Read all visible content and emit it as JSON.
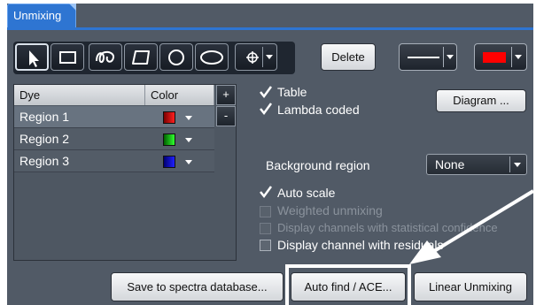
{
  "tab": {
    "title": "Unmixing"
  },
  "toolbar": {
    "tools": [
      {
        "icon": "arrow-pointer-icon",
        "active": true
      },
      {
        "icon": "rectangle-icon"
      },
      {
        "icon": "bezier-icon"
      },
      {
        "icon": "polygon-icon"
      },
      {
        "icon": "circle-icon"
      },
      {
        "icon": "ellipse-icon"
      },
      {
        "icon": "crosshair-icon"
      }
    ],
    "delete_label": "Delete",
    "line_style_icon": "line-style-icon",
    "color_value": "#ff0000"
  },
  "dye_table": {
    "headers": {
      "dye": "Dye",
      "color": "Color",
      "add": "+",
      "remove": "-"
    },
    "rows": [
      {
        "name": "Region 1",
        "color": "#d40000"
      },
      {
        "name": "Region 2",
        "color": "#00c000"
      },
      {
        "name": "Region 3",
        "color": "#0000cc"
      }
    ]
  },
  "options": {
    "table": "Table",
    "lambda_coded": "Lambda coded",
    "diagram": "Diagram ...",
    "background_region_label": "Background region",
    "background_region_value": "None",
    "auto_scale": "Auto scale",
    "weighted_unmixing": "Weighted unmixing",
    "display_stat_confidence": "Display channels with statistical confidence",
    "display_residuals": "Display channel with residuals"
  },
  "actions": {
    "save": "Save to spectra database...",
    "auto_find": "Auto find / ACE...",
    "linear": "Linear Unmixing"
  },
  "colors": {
    "panel": "#515a66",
    "tab": "#2e75d2",
    "highlight_frame": "#ffffff"
  }
}
